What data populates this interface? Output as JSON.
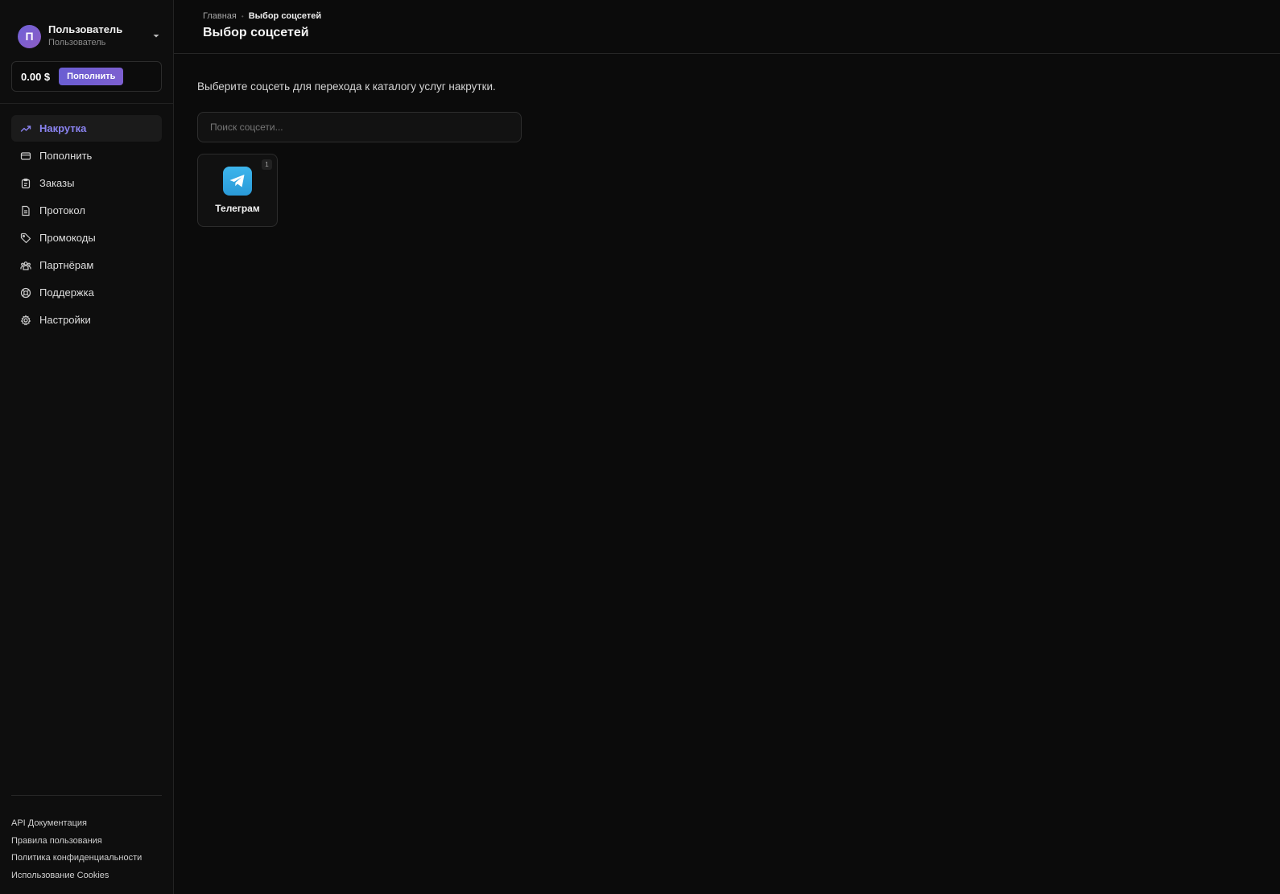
{
  "user": {
    "avatar_letter": "П",
    "name": "Пользователь",
    "role": "Пользователь"
  },
  "balance": {
    "amount": "0.00 $",
    "topup_label": "Пополнить"
  },
  "nav": {
    "items": [
      {
        "label": "Накрутка",
        "icon": "trending-up-icon",
        "active": true
      },
      {
        "label": "Пополнить",
        "icon": "credit-card-icon",
        "active": false
      },
      {
        "label": "Заказы",
        "icon": "clipboard-icon",
        "active": false
      },
      {
        "label": "Протокол",
        "icon": "document-icon",
        "active": false
      },
      {
        "label": "Промокоды",
        "icon": "tag-icon",
        "active": false
      },
      {
        "label": "Партнёрам",
        "icon": "users-icon",
        "active": false
      },
      {
        "label": "Поддержка",
        "icon": "lifebuoy-icon",
        "active": false
      },
      {
        "label": "Настройки",
        "icon": "gear-icon",
        "active": false
      }
    ]
  },
  "footer": {
    "links": [
      "API Документация",
      "Правила пользования",
      "Политика конфиденциальности",
      "Использование Cookies"
    ]
  },
  "header": {
    "breadcrumb_home": "Главная",
    "breadcrumb_current": "Выбор соцсетей",
    "title": "Выбор соцсетей"
  },
  "main": {
    "intro": "Выберите соцсеть для перехода к каталогу услуг накрутки.",
    "search_placeholder": "Поиск соцсети...",
    "networks": [
      {
        "label": "Телеграм",
        "count": "1",
        "icon": "telegram-icon"
      }
    ]
  },
  "colors": {
    "accent": "#7b6ee8",
    "background": "#0b0b0b",
    "telegram": "#2aa3e0"
  }
}
